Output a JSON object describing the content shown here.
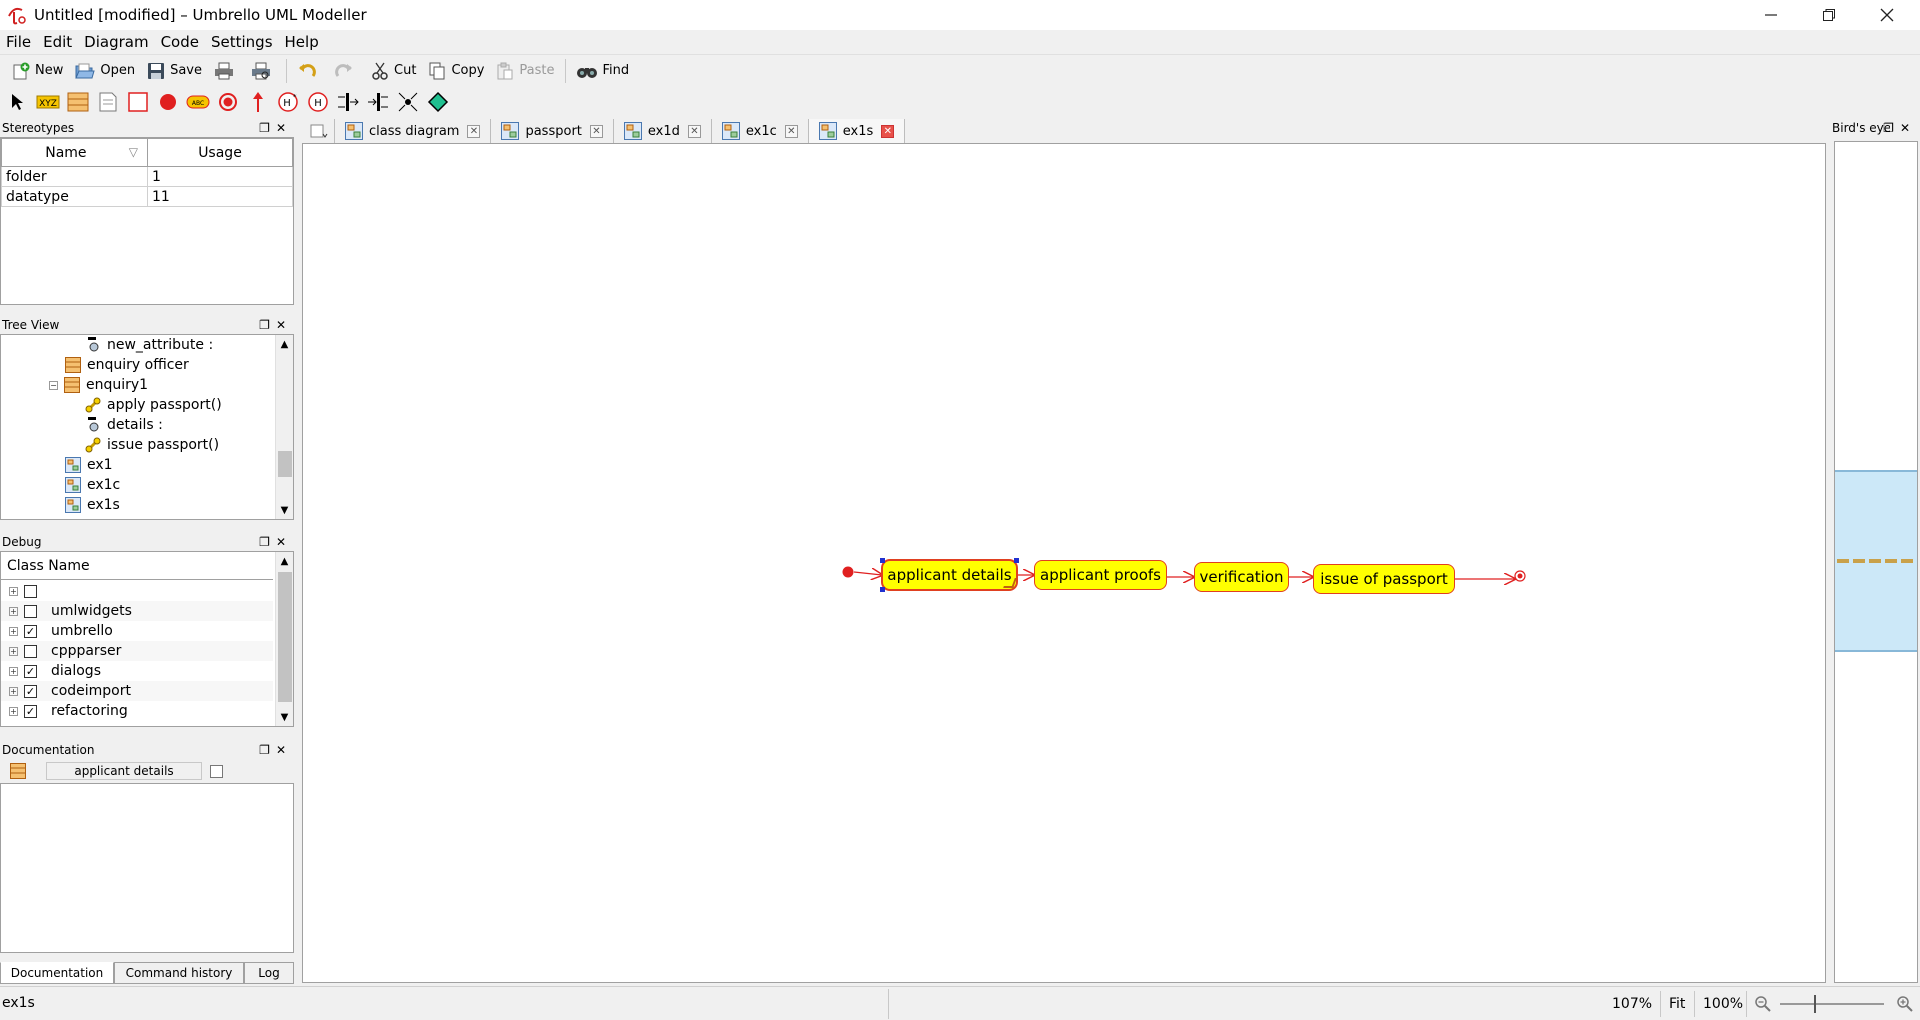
{
  "window": {
    "title": "Untitled [modified] – Umbrello UML Modeller",
    "controls": [
      "minimize",
      "restore",
      "close"
    ]
  },
  "menu": [
    "File",
    "Edit",
    "Diagram",
    "Code",
    "Settings",
    "Help"
  ],
  "toolbar": {
    "new": "New",
    "open": "Open",
    "save": "Save",
    "cut": "Cut",
    "copy": "Copy",
    "paste": "Paste",
    "find": "Find"
  },
  "stereotypes": {
    "title": "Stereotypes",
    "columns": [
      "Name",
      "Usage"
    ],
    "rows": [
      {
        "name": "folder",
        "usage": "1"
      },
      {
        "name": "datatype",
        "usage": "11"
      }
    ]
  },
  "tree_view": {
    "title": "Tree View",
    "items": [
      {
        "label": "new_attribute :",
        "icon": "attribute-icon",
        "indent": 3
      },
      {
        "label": "enquiry officer",
        "icon": "class-icon",
        "indent": 2
      },
      {
        "label": "enquiry1",
        "icon": "class-icon",
        "indent": 2
      },
      {
        "label": "apply passport()",
        "icon": "operation-icon",
        "indent": 3
      },
      {
        "label": "details :",
        "icon": "attribute-icon",
        "indent": 3
      },
      {
        "label": "issue passport()",
        "icon": "operation-icon",
        "indent": 3
      },
      {
        "label": "ex1",
        "icon": "diagram-icon",
        "indent": 2
      },
      {
        "label": "ex1c",
        "icon": "diagram-icon",
        "indent": 2
      },
      {
        "label": "ex1s",
        "icon": "diagram-icon",
        "indent": 2
      }
    ]
  },
  "debug": {
    "title": "Debug",
    "column": "Class Name",
    "rows": [
      {
        "label": "",
        "checked": false
      },
      {
        "label": "umlwidgets",
        "checked": false
      },
      {
        "label": "umbrello",
        "checked": true
      },
      {
        "label": "cppparser",
        "checked": false
      },
      {
        "label": "dialogs",
        "checked": true
      },
      {
        "label": "codeimport",
        "checked": true
      },
      {
        "label": "refactoring",
        "checked": true
      }
    ]
  },
  "documentation": {
    "title": "Documentation",
    "selected": "applicant details",
    "text": ""
  },
  "bottom_tabs": [
    "Documentation",
    "Command history",
    "Log"
  ],
  "tabs": [
    {
      "label": "class diagram",
      "active": false
    },
    {
      "label": "passport",
      "active": false
    },
    {
      "label": "ex1d",
      "active": false
    },
    {
      "label": "ex1c",
      "active": false
    },
    {
      "label": "ex1s",
      "active": true
    }
  ],
  "diagram": {
    "states": [
      "applicant details",
      "applicant proofs",
      "verification",
      "issue of passport"
    ],
    "state_fill": "#ffff00",
    "state_border": "#e04020",
    "arrow_color": "#e02020"
  },
  "birdseye": {
    "title": "Bird's eye"
  },
  "status": {
    "left": "ex1s",
    "zoom": "107%",
    "fit": "Fit",
    "zoom100": "100%"
  }
}
